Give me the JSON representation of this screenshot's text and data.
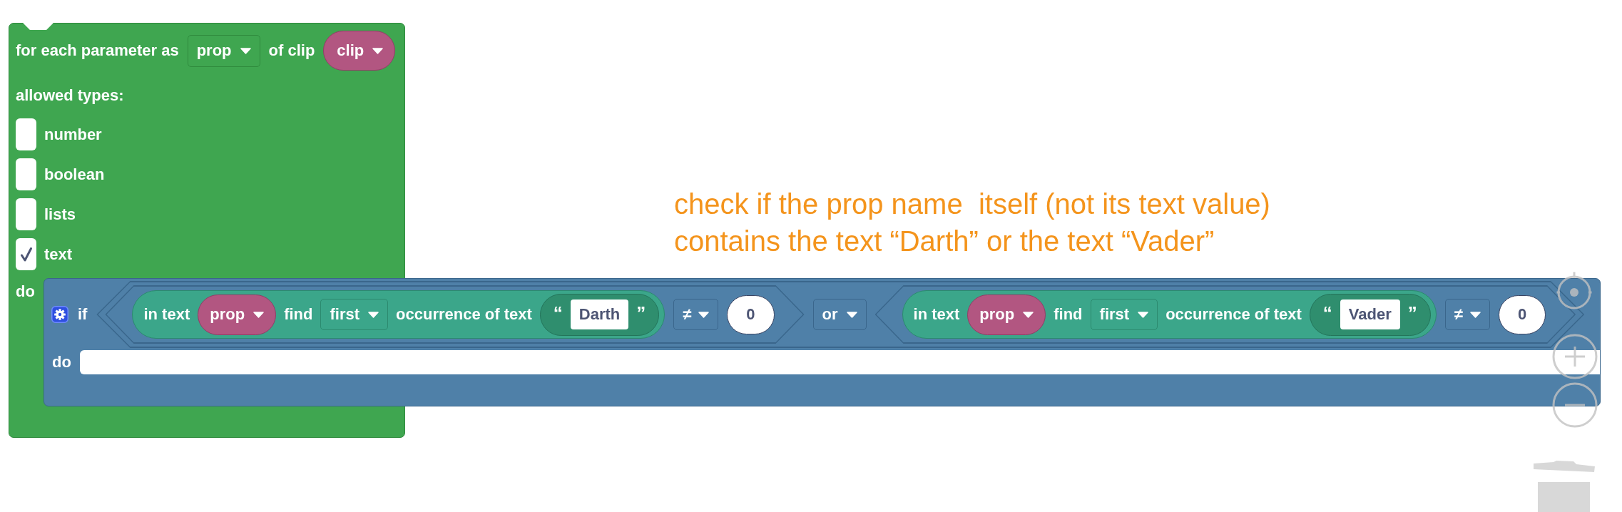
{
  "loop_block": {
    "label": "for each parameter as",
    "variable": "prop",
    "of_label": "of clip",
    "clip": "clip",
    "allowed_label": "allowed types:",
    "types": [
      {
        "label": "number",
        "checked": false
      },
      {
        "label": "boolean",
        "checked": false
      },
      {
        "label": "lists",
        "checked": false
      },
      {
        "label": "text",
        "checked": true
      }
    ],
    "do_label": "do",
    "if_block": {
      "if_label": "if",
      "condition": {
        "operator": "or",
        "operands": [
          {
            "in_text_label": "in text",
            "variable": "prop",
            "find_label": "find",
            "position": "first",
            "occurrence_label": "occurrence of text",
            "open_quote": "“",
            "search_text": "Darth",
            "close_quote": "”",
            "comparator": "≠",
            "value": "0"
          },
          {
            "in_text_label": "in text",
            "variable": "prop",
            "find_label": "find",
            "position": "first",
            "occurrence_label": "occurrence of text",
            "open_quote": "“",
            "search_text": "Vader",
            "close_quote": "”",
            "comparator": "≠",
            "value": "0"
          }
        ]
      },
      "do_label": "do"
    }
  },
  "comment": {
    "text": "check if the prop name  itself (not its text value)\ncontains the text “Darth” or the text “Vader”"
  }
}
